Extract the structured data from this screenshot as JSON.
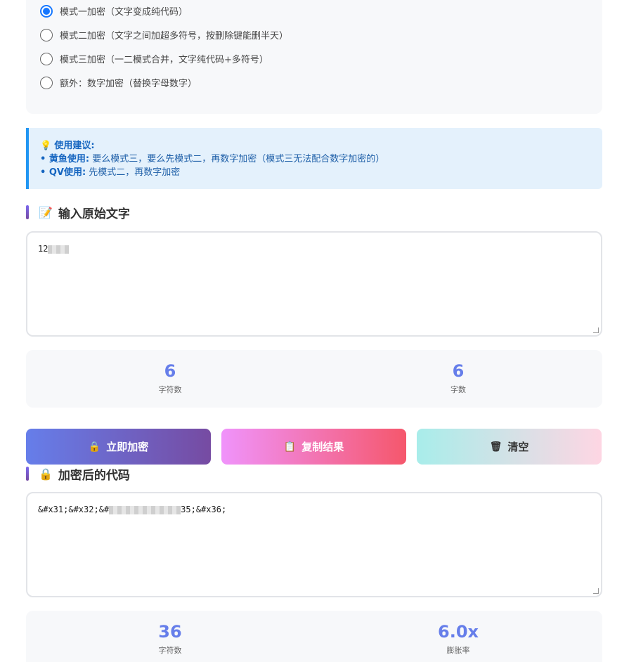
{
  "modes": [
    {
      "label": "模式一加密（文字变成纯代码）",
      "checked": true
    },
    {
      "label": "模式二加密（文字之间加超多符号，按删除键能删半天）",
      "checked": false
    },
    {
      "label": "模式三加密（一二模式合并，文字纯代码+多符号）",
      "checked": false
    },
    {
      "label": "额外：数字加密（替换字母数字）",
      "checked": false
    }
  ],
  "tips": {
    "icon": "💡",
    "title": "使用建议:",
    "line1_label": "• 黄鱼使用:",
    "line1_text": "要么模式三，要么先模式二，再数字加密（模式三无法配合数字加密的）",
    "line2_label": "• QV使用:",
    "line2_text": "先模式二，再数字加密"
  },
  "input_section": {
    "icon": "📝",
    "title": "输入原始文字",
    "value_visible": "12"
  },
  "input_stats": [
    {
      "value": "6",
      "label": "字符数"
    },
    {
      "value": "6",
      "label": "字数"
    }
  ],
  "buttons": {
    "encrypt": {
      "icon": "🔒",
      "label": "立即加密"
    },
    "copy": {
      "icon": "📋",
      "label": "复制结果"
    },
    "clear": {
      "icon": "🗑",
      "label": "清空"
    }
  },
  "output_section": {
    "icon": "🔒",
    "title": "加密后的代码",
    "value_start": "&#x31;&#x32;&#",
    "value_end": "35;&#x36;"
  },
  "output_stats": [
    {
      "value": "36",
      "label": "字符数"
    },
    {
      "value": "6.0x",
      "label": "膨胀率"
    }
  ],
  "colors": {
    "accent": "#667eea",
    "radio_active": "#1677ff",
    "tip_border": "#2196f3"
  }
}
